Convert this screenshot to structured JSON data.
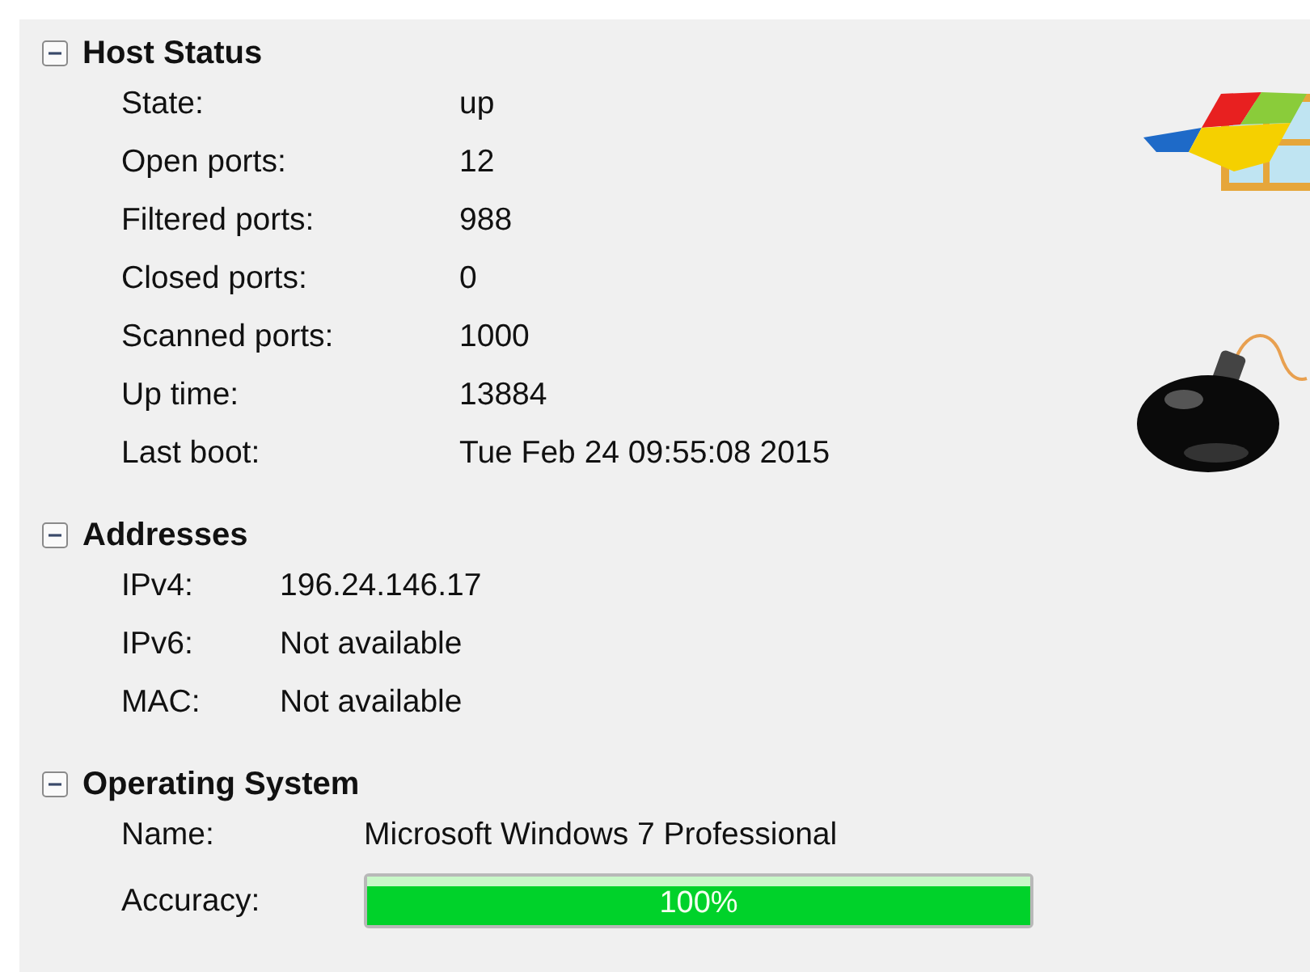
{
  "sections": [
    {
      "title": "Host Status",
      "expanded": true,
      "rows": [
        {
          "kind": "text",
          "label": "State:",
          "value": "up"
        },
        {
          "kind": "text",
          "label": "Open ports:",
          "value": "12"
        },
        {
          "kind": "text",
          "label": "Filtered ports:",
          "value": "988"
        },
        {
          "kind": "text",
          "label": "Closed ports:",
          "value": "0"
        },
        {
          "kind": "text",
          "label": "Scanned ports:",
          "value": "1000"
        },
        {
          "kind": "text",
          "label": "Up time:",
          "value": "13884"
        },
        {
          "kind": "text",
          "label": "Last boot:",
          "value": "Tue Feb 24 09:55:08 2015"
        }
      ]
    },
    {
      "title": "Addresses",
      "expanded": true,
      "rows": [
        {
          "kind": "text",
          "label": "IPv4:",
          "value": "196.24.146.17"
        },
        {
          "kind": "text",
          "label": "IPv6:",
          "value": "Not available"
        },
        {
          "kind": "text",
          "label": "MAC:",
          "value": "Not available"
        }
      ]
    },
    {
      "title": "Operating System",
      "expanded": true,
      "rows": [
        {
          "kind": "text",
          "label": "Name:",
          "value": "Microsoft Windows 7 Professional"
        },
        {
          "kind": "meter",
          "label": "Accuracy:",
          "level": 1,
          "value": "100%"
        }
      ]
    }
  ]
}
